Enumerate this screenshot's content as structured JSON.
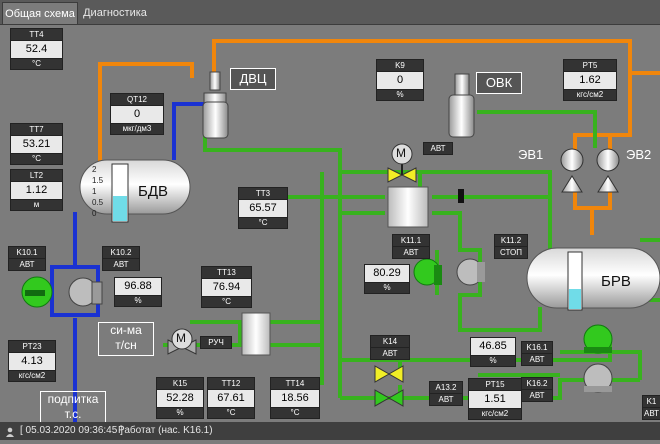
{
  "tabs": [
    {
      "label": "Общая схема",
      "active": true
    },
    {
      "label": "Диагностика",
      "active": false
    }
  ],
  "colors": {
    "orange": "#f0860c",
    "blue": "#1a32d2",
    "green": "#38b21e",
    "yellow": "#f1ee26",
    "bg": "#7c7c7c"
  },
  "units": {
    "deg": "°C",
    "pct": "%",
    "pressure": "кгс/см2",
    "conductivity": "мкг/дм3",
    "meters": "м"
  },
  "sensors": {
    "tt4": {
      "tag": "TT4",
      "value": "52.4"
    },
    "tt7": {
      "tag": "TT7",
      "value": "53.21"
    },
    "lt2": {
      "tag": "LT2",
      "value": "1.12"
    },
    "qt12": {
      "tag": "QT12",
      "value": "0"
    },
    "k9": {
      "tag": "K9",
      "value": "0"
    },
    "pt5": {
      "tag": "PT5",
      "value": "1.62"
    },
    "tt3": {
      "tag": "TT3",
      "value": "65.57"
    },
    "k10_1_value": "96.88",
    "tt13": {
      "tag": "TT13",
      "value": "76.94"
    },
    "k11_1": {
      "value": "80.29"
    },
    "pt23": {
      "tag": "PT23",
      "value": "4.13"
    },
    "k15": {
      "tag": "K15",
      "value": "52.28"
    },
    "tt12": {
      "tag": "TT12",
      "value": "67.61"
    },
    "tt14": {
      "tag": "TT14",
      "value": "18.56"
    },
    "pt15": {
      "tag": "PT15",
      "value": "1.51"
    },
    "k16_1_value": "46.85"
  },
  "tags": {
    "k10_1": "K10.1",
    "k10_2": "K10.2",
    "k11_1": "K11.1",
    "k11_2": "K11.2",
    "k14": "K14",
    "k16_1": "K16.1",
    "k16_2": "K16.2",
    "a13_2": "A13.2",
    "k1x": "K1"
  },
  "modes": {
    "avt": "АВТ",
    "stop": "СТОП",
    "manual": "РУЧ"
  },
  "motor_letter": "M",
  "equipment": {
    "dvc": "ДВЦ",
    "ovk": "ОВК",
    "bdv": "БДВ",
    "brv": "БРВ",
    "ev1": "ЭВ1",
    "ev2": "ЭВ2"
  },
  "bdv_scale": [
    "2",
    "1.5",
    "1",
    "0.5",
    "0"
  ],
  "bdv_level": 0.44,
  "brv_level": 0.35,
  "labels": {
    "sima_line1": "си-ма",
    "sima_line2": "т/сн",
    "podpitka_line1": "подпитка",
    "podpitka_line2": "т.с."
  },
  "status": {
    "datetime": "[ 05.03.2020 09:36:45 ]",
    "message": "Работат (нас. K16.1)"
  }
}
